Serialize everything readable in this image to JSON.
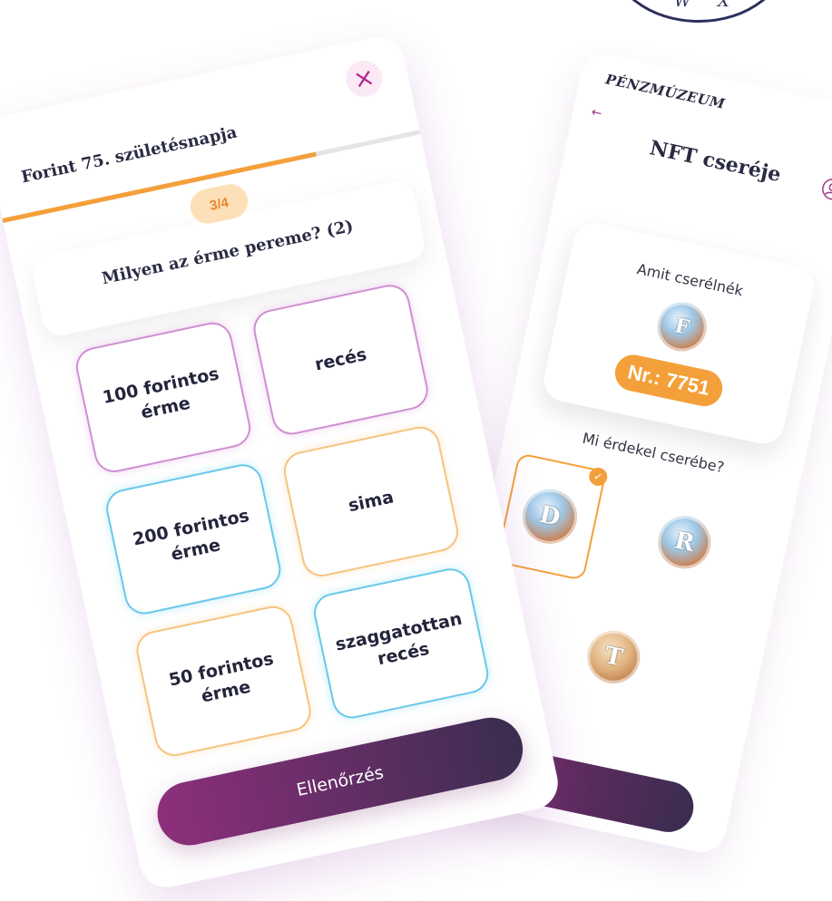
{
  "seal": {
    "letters": [
      "W",
      "X"
    ]
  },
  "nft_screen": {
    "brand": "PÉNZMÚZEUM",
    "title": "NFT cseréje",
    "offer_label": "Amit cserélnék",
    "offer_coin_letter": "F",
    "offer_number": "Nr.: 7751",
    "question": "Mi érdekel cserébe?",
    "coins": [
      {
        "letter": "D",
        "selected": true
      },
      {
        "letter": "R",
        "selected": false
      },
      {
        "letter": "T",
        "selected": false
      }
    ],
    "icons": {
      "back": "arrow-left-icon",
      "profile": "user-profile-icon",
      "selected": "check-icon"
    }
  },
  "quiz_screen": {
    "title": "Forint 75. születésnapja",
    "step": "3/4",
    "progress": 0.75,
    "question": "Milyen az érme pereme? (2)",
    "tiles": [
      {
        "label": "100 forintos érme",
        "color": "pink"
      },
      {
        "label": "recés",
        "color": "pink"
      },
      {
        "label": "200 forintos érme",
        "color": "blue"
      },
      {
        "label": "sima",
        "color": "orange"
      },
      {
        "label": "50 forintos érme",
        "color": "orange"
      },
      {
        "label": "szaggatottan recés",
        "color": "blue"
      }
    ],
    "submit_label": "Ellenőrzés",
    "icons": {
      "close": "close-icon"
    }
  },
  "colors": {
    "accent_orange": "#f4a03a",
    "accent_pink": "#d08fd3",
    "accent_blue": "#68c8ea",
    "brand_purple": "#8e2f7c",
    "brand_dark": "#3a2d4f",
    "text_dark": "#2a2b43"
  }
}
